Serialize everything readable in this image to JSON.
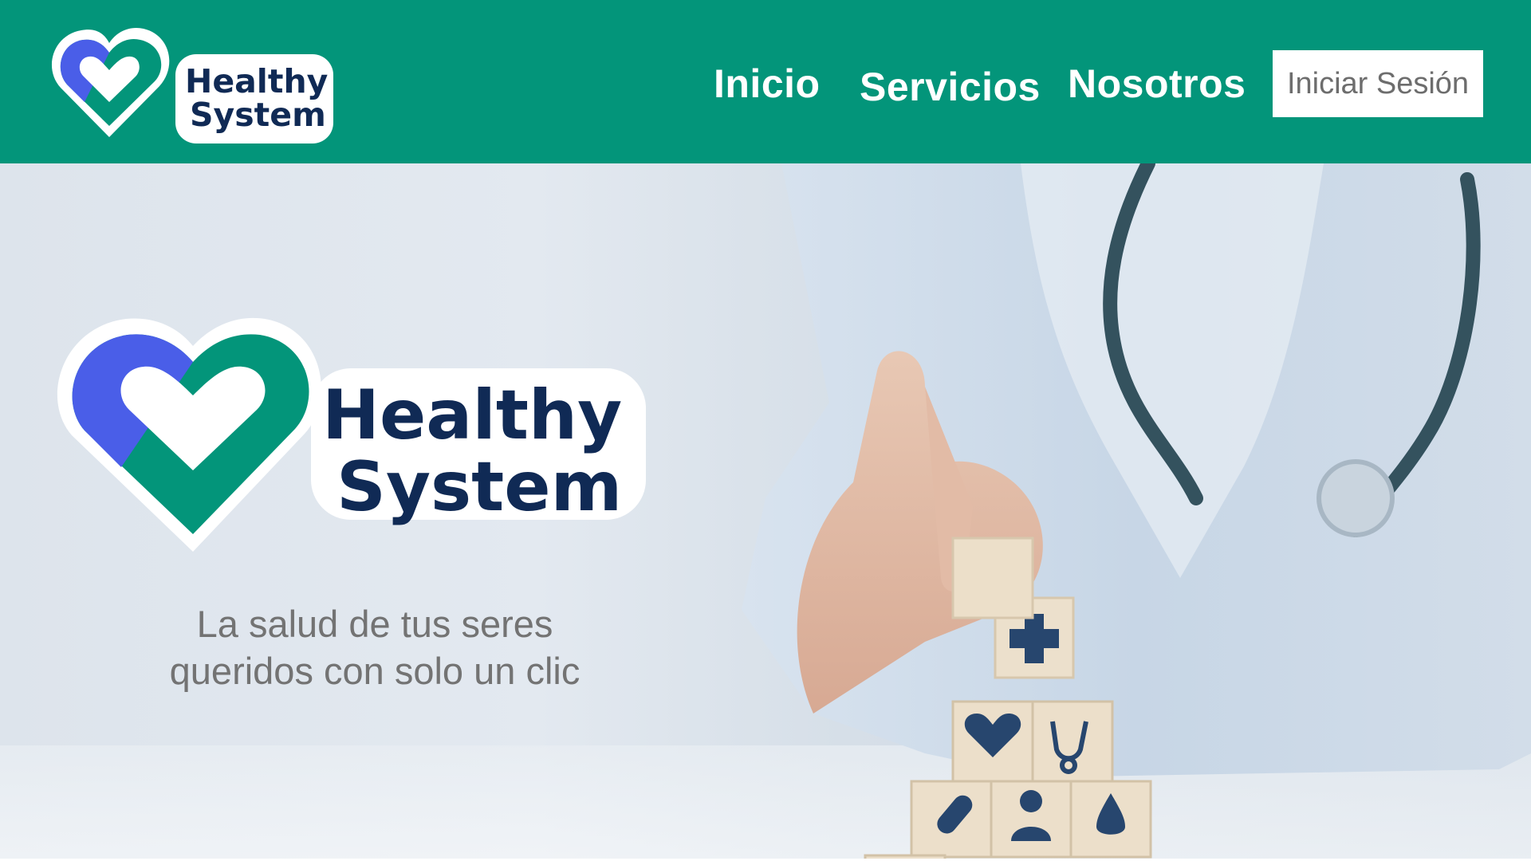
{
  "brand": {
    "name_line1": "Healthy",
    "name_line2": "System",
    "colors": {
      "green": "#03957a",
      "blue": "#4a5ee8",
      "navy": "#102a55"
    }
  },
  "navbar": {
    "links": [
      {
        "label": "Inicio"
      },
      {
        "label": "Servicios"
      },
      {
        "label": "Nosotros"
      }
    ],
    "login_label": "Iniciar Sesión"
  },
  "hero": {
    "tagline_line1": "La salud de tus seres",
    "tagline_line2": "queridos con solo un clic",
    "photo_icons": [
      "plus-icon",
      "heart-pulse-icon",
      "stethoscope-icon",
      "bandage-icon",
      "doctor-icon",
      "drop-icon",
      "medical-kit-icon",
      "pills-icon",
      "wheelchair-icon",
      "syringe-icon"
    ]
  }
}
